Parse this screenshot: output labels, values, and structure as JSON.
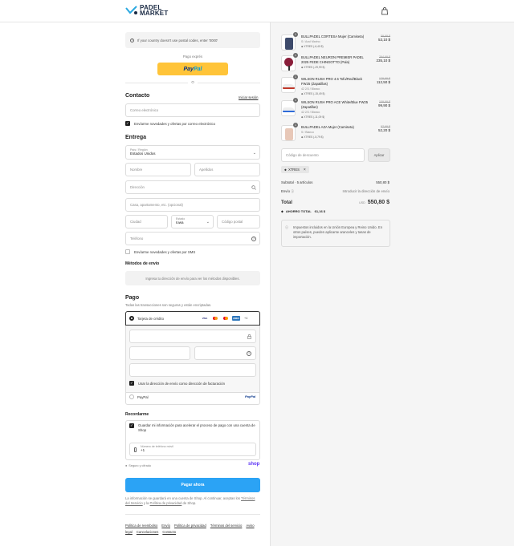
{
  "brand": {
    "line1": "PADEL",
    "line2": "MARKET"
  },
  "notice": "If your country doesn't use postal codes, enter '0000'",
  "express": {
    "label": "Pago exprés",
    "paypal_a": "Pay",
    "paypal_b": "Pal",
    "or": "O"
  },
  "contact": {
    "title": "Contacto",
    "login_link": "Iniciar sesión",
    "email_placeholder": "Correo electrónico",
    "newsletter": "Envíarme novedades y ofertas por correo electrónico"
  },
  "delivery": {
    "title": "Entrega",
    "country_label": "País / Región",
    "country_value": "Estados Unidos",
    "first_name": "Nombre",
    "last_name": "Apellidos",
    "address": "Dirección",
    "apartment": "Casa, apartamento, etc. (opcional)",
    "city": "Ciudad",
    "state_label": "Estado",
    "state_value": "Iowa",
    "zip": "Código postal",
    "phone": "Teléfono",
    "sms": "Envíarme novedades y ofertas por SMS"
  },
  "shipping": {
    "title": "Métodos de envío",
    "message": "Ingresa tu dirección de envío para ver los métodos disponibles."
  },
  "payment": {
    "title": "Pago",
    "subtitle": "Todas las transacciones son seguras y están encriptadas.",
    "credit_card": "Tarjeta de crédito",
    "more_cards": "+4",
    "billing_same": "Usar la dirección de envío como dirección de facturación",
    "paypal": "PayPal"
  },
  "remember": {
    "title": "Recordarme",
    "text": "Guardar mi información para acelerar el proceso de pago con una cuenta de Shop",
    "phone_label": "Número de teléfono móvil",
    "phone_value": "+1",
    "secure": "Seguro y cifrado",
    "shop": "shop"
  },
  "pay_button": "Pagar ahora",
  "legal": {
    "text": "La información se guardará en una cuenta de Shop. Al continuar, aceptas los",
    "terms": "Términos del Servicio",
    "and": "y la",
    "privacy": "Política de privacidad",
    "tail": "de Shop."
  },
  "footer_links": [
    "Política de reembolso",
    "Envío",
    "Política de privacidad",
    "Términos del servicio",
    "Aviso legal",
    "Cancelaciones",
    "Contacto"
  ],
  "items": [
    {
      "qty": "1",
      "name": "BULLPADEL CORTESA Mujer (Camiseta)",
      "variant": "S / Azul Marino",
      "discount": "XTRES (-6,40 $)",
      "old": "59,99 $",
      "price": "53,10 $",
      "color": "#3d4a6b"
    },
    {
      "qty": "1",
      "name": "BULLPADEL NEURON PREMIER PADEL 2025 FEDE CHINGOTTO (Pala)",
      "variant": "",
      "discount": "XTRES (-29,99 $)",
      "old": "264,99 $",
      "price": "235,10 $",
      "color": "#8a1e3a"
    },
    {
      "qty": "1",
      "name": "WILSON RUSH PRO 4.5 Tofu/Red/Black FW25 (Zapatillas)",
      "variant": "42 2/3 / Blanco",
      "discount": "XTRES (-15,49 $)",
      "old": "129,99 $",
      "price": "112,50 $",
      "color": "#c0392b"
    },
    {
      "qty": "1",
      "name": "WILSON RUSH PRO ACE White/Blue FW25 (Zapatillas)",
      "variant": "42 2/3 / Blanco",
      "discount": "XTRES (-11,09 $)",
      "old": "109,99 $",
      "price": "99,90 $",
      "color": "#2f6bd8"
    },
    {
      "qty": "1",
      "name": "BULLPADEL AZA Mujer (Camiseta)",
      "variant": "S / Blanco",
      "discount": "XTRES (-5,79 $)",
      "old": "57,99 $",
      "price": "52,20 $",
      "color": "#e8c8b8"
    }
  ],
  "discount": {
    "placeholder": "Código de descuento",
    "apply": "Aplicar",
    "tag": "XTRES"
  },
  "summary": {
    "subtotal_label": "Subtotal · 5 artículos",
    "subtotal": "550,80 $",
    "shipping_label": "Envío",
    "shipping_value": "Introducir la dirección de envío",
    "total_label": "Total",
    "currency": "USD",
    "total": "550,80 $",
    "savings_label": "AHORRO TOTAL",
    "savings": "61,16 $",
    "tax_note": "Impuestos incluidos en la Unión Europea y Reino Unido. En otros países, pueden aplicarse aranceles y tasas de importación."
  }
}
